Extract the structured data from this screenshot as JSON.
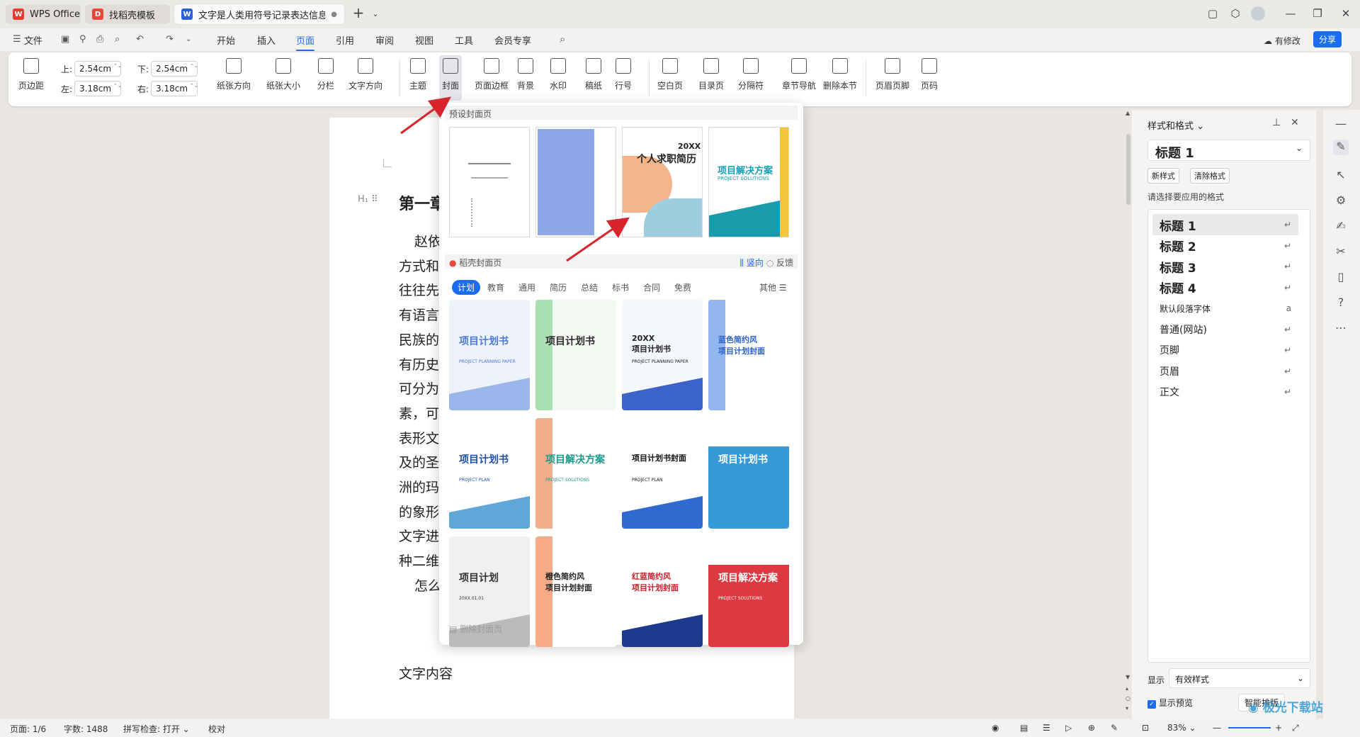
{
  "tabs": [
    {
      "label": "WPS Office",
      "icon": "wps-logo-icon"
    },
    {
      "label": "找稻壳模板",
      "icon": "docer-icon"
    },
    {
      "label": "文字是人类用符号记录表达信息以",
      "icon": "word-doc-icon"
    }
  ],
  "menu": {
    "file": "文件",
    "items": [
      "开始",
      "插入",
      "页面",
      "引用",
      "审阅",
      "视图",
      "工具",
      "会员专享"
    ],
    "selected": "页面",
    "has_changes": "有修改",
    "share": "分享"
  },
  "ribbon": {
    "margins_label": "页边距",
    "top_label": "上:",
    "top_value": "2.54",
    "bottom_label": "下:",
    "bottom_value": "2.54",
    "left_label": "左:",
    "left_value": "3.18",
    "right_label": "右:",
    "right_value": "3.18",
    "unit": "cm",
    "buttons": [
      "纸张方向",
      "纸张大小",
      "分栏",
      "文字方向",
      "主题",
      "封面",
      "页面边框",
      "背景",
      "水印",
      "稿纸",
      "行号",
      "空白页",
      "目录页",
      "分隔符",
      "章节导航",
      "删除本节",
      "页眉页脚",
      "页码"
    ]
  },
  "popup": {
    "preset_title": "预设封面页",
    "preset_resume_year": "20XX",
    "preset_resume_title": "个人求职简历",
    "preset_solution_title": "项目解决方案",
    "preset_solution_sub": "PROJECT SOLUTIONS",
    "docer_title": "稻壳封面页",
    "orientation": "竖向",
    "feedback": "反馈",
    "categories": [
      "计划",
      "教育",
      "通用",
      "简历",
      "总结",
      "标书",
      "合同",
      "免费"
    ],
    "more": "其他",
    "templates": [
      {
        "title": "项目计划书",
        "sub": "PROJECT PLANNING PAPER"
      },
      {
        "title": "项目计划书",
        "sub": ""
      },
      {
        "title": "20XX\n项目计划书",
        "sub": "PROJECT PLANNING PAPER"
      },
      {
        "title": "蓝色简约风\n项目计划封面",
        "sub": ""
      },
      {
        "title": "项目计划书",
        "sub": "PROJECT PLAN"
      },
      {
        "title": "项目解决方案",
        "sub": "PROJECT SOLUTIONS"
      },
      {
        "title": "项目计划书封面",
        "sub": "PROJECT PLAN"
      },
      {
        "title": "项目计划书",
        "sub": ""
      },
      {
        "title": "项目计划",
        "sub": "20XX.01.01"
      },
      {
        "title": "橙色简约风\n项目计划封面",
        "sub": ""
      },
      {
        "title": "红蓝简约风\n项目计划封面",
        "sub": ""
      },
      {
        "title": "项目解决方案",
        "sub": "PROJECT SOLUTIONS"
      }
    ],
    "delete_cover": "删除封面页"
  },
  "document": {
    "heading": "第一章",
    "lines": [
      "赵依",
      "方式和",
      "往往先",
      "有语言",
      "民族的",
      "有历史",
      "可分为",
      "素，可",
      "表形文",
      "及的圣",
      "洲的玛",
      "的象形",
      "文字进",
      "种二维",
      "怎么"
    ],
    "bottom_text": "文字内容"
  },
  "style_panel": {
    "title": "样式和格式",
    "current": "标题 1",
    "new_style": "新样式",
    "clear_format": "清除格式",
    "hint": "请选择要应用的格式",
    "styles": [
      "标题 1",
      "标题 2",
      "标题 3",
      "标题 4",
      "默认段落字体",
      "普通(网站)",
      "页脚",
      "页眉",
      "正文"
    ],
    "show_label": "显示",
    "show_value": "有效样式",
    "preview_label": "显示预览",
    "smart_layout": "智能排版"
  },
  "status": {
    "page": "页面: 1/6",
    "words": "字数: 1488",
    "spell": "拼写检查: 打开",
    "proof": "校对",
    "zoom": "83%"
  },
  "watermark": "极光下载站",
  "colors": {
    "accent": "#1a6cf0",
    "arrow": "#d8242c"
  }
}
